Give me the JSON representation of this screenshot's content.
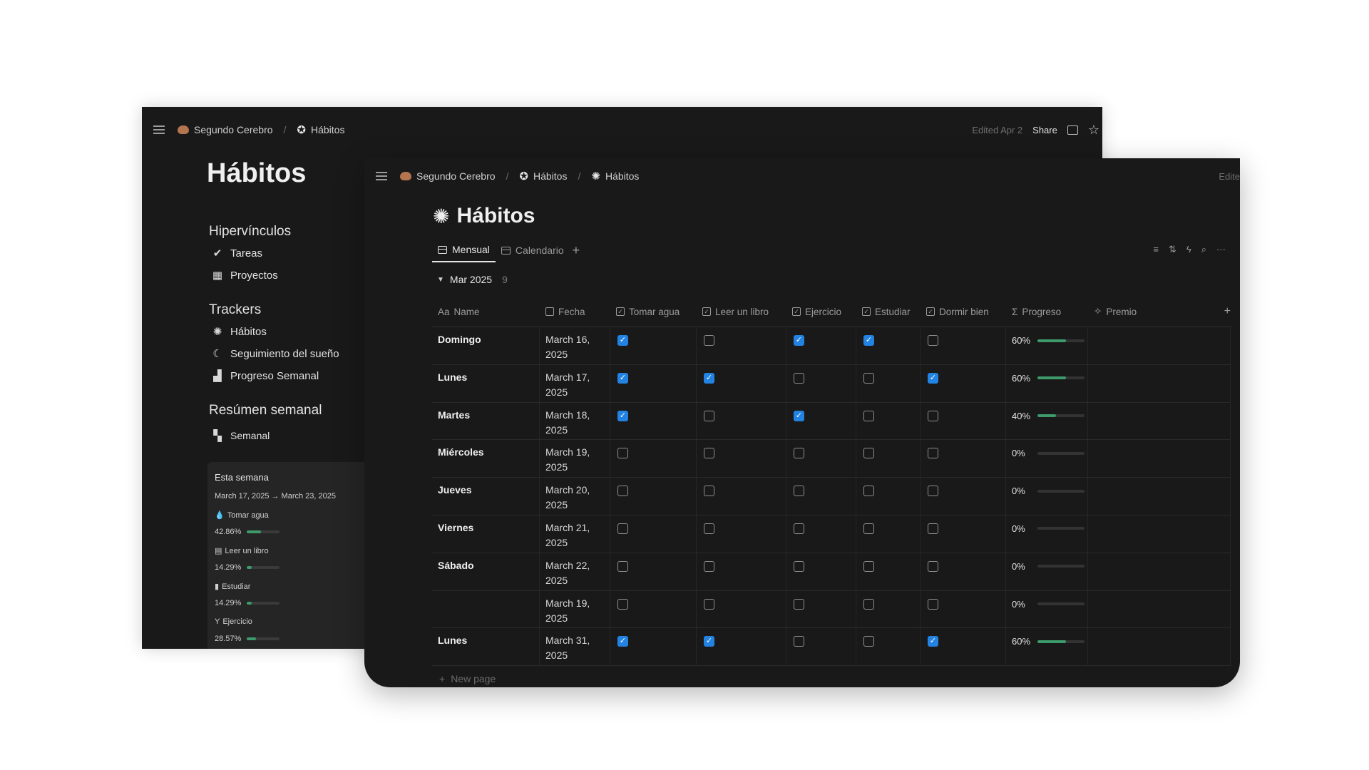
{
  "back": {
    "breadcrumb": [
      "Segundo Cerebro",
      "Hábitos"
    ],
    "edited": "Edited Apr 2",
    "share": "Share",
    "title": "Hábitos",
    "sections": [
      {
        "heading": "Hipervínculos",
        "links": [
          {
            "icon": "checklist-icon",
            "label": "Tareas"
          },
          {
            "icon": "projects-icon",
            "label": "Proyectos"
          }
        ]
      },
      {
        "heading": "Trackers",
        "links": [
          {
            "icon": "sparkle-gear-icon",
            "label": "Hábitos"
          },
          {
            "icon": "moon-icon",
            "label": "Seguimiento del sueño"
          },
          {
            "icon": "chart-icon",
            "label": "Progreso Semanal"
          }
        ]
      },
      {
        "heading": "Resúmen semanal",
        "links": [
          {
            "icon": "gallery-icon",
            "label": "Semanal"
          }
        ]
      }
    ],
    "week_card": {
      "title": "Esta semana",
      "range": "March 17, 2025 → March 23, 2025",
      "stats": [
        {
          "label": "Tomar agua",
          "icon": "drop-icon",
          "pct_text": "42.86%",
          "value": 0.4286
        },
        {
          "label": "Leer un libro",
          "icon": "book-icon",
          "pct_text": "14.29%",
          "value": 0.1429
        },
        {
          "label": "Estudiar",
          "icon": "document-icon",
          "pct_text": "14.29%",
          "value": 0.1429
        },
        {
          "label": "Ejercicio",
          "icon": "exercise-icon",
          "pct_text": "28.57%",
          "value": 0.2857
        }
      ]
    }
  },
  "front": {
    "breadcrumb": [
      "Segundo Cerebro",
      "Hábitos",
      "Hábitos"
    ],
    "edited_partial": "Edite",
    "title": "Hábitos",
    "views": [
      "Mensual",
      "Calendario"
    ],
    "group": {
      "label": "Mar 2025",
      "count": "9"
    },
    "columns": {
      "name": "Name",
      "name_prefix": "Aa",
      "fecha": "Fecha",
      "agua": "Tomar agua",
      "libro": "Leer un libro",
      "ejercicio": "Ejercicio",
      "estudiar": "Estudiar",
      "dormir": "Dormir bien",
      "progreso": "Progreso",
      "premio": "Premio"
    },
    "rows": [
      {
        "name": "Domingo",
        "date1": "March 16,",
        "date2": "2025",
        "checks": [
          true,
          false,
          true,
          true,
          false
        ],
        "pct_text": "60%",
        "value": 0.6
      },
      {
        "name": "Lunes",
        "date1": "March 17,",
        "date2": "2025",
        "checks": [
          true,
          true,
          false,
          false,
          true
        ],
        "pct_text": "60%",
        "value": 0.6
      },
      {
        "name": "Martes",
        "date1": "March 18,",
        "date2": "2025",
        "checks": [
          true,
          false,
          true,
          false,
          false
        ],
        "pct_text": "40%",
        "value": 0.4
      },
      {
        "name": "Miércoles",
        "date1": "March 19,",
        "date2": "2025",
        "checks": [
          false,
          false,
          false,
          false,
          false
        ],
        "pct_text": "0%",
        "value": 0
      },
      {
        "name": "Jueves",
        "date1": "March 20,",
        "date2": "2025",
        "checks": [
          false,
          false,
          false,
          false,
          false
        ],
        "pct_text": "0%",
        "value": 0
      },
      {
        "name": "Viernes",
        "date1": "March 21,",
        "date2": "2025",
        "checks": [
          false,
          false,
          false,
          false,
          false
        ],
        "pct_text": "0%",
        "value": 0
      },
      {
        "name": "Sábado",
        "date1": "March 22,",
        "date2": "2025",
        "checks": [
          false,
          false,
          false,
          false,
          false
        ],
        "pct_text": "0%",
        "value": 0
      },
      {
        "name": "",
        "date1": "March 19,",
        "date2": "2025",
        "checks": [
          false,
          false,
          false,
          false,
          false
        ],
        "pct_text": "0%",
        "value": 0
      },
      {
        "name": "Lunes",
        "date1": "March 31,",
        "date2": "2025",
        "checks": [
          true,
          true,
          false,
          false,
          true
        ],
        "pct_text": "60%",
        "value": 0.6
      }
    ],
    "new_page": "New page"
  },
  "colors": {
    "accent": "#2383e2",
    "progress": "#3d9a6b",
    "bg": "#191919"
  }
}
